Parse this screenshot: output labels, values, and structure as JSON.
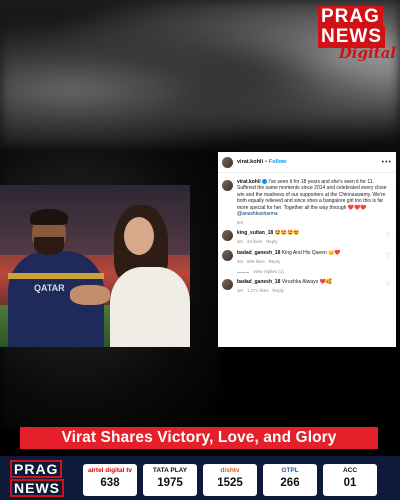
{
  "brand": {
    "logo_line1": "PRAG",
    "logo_line2": "NEWS",
    "logo_line3": "Digital",
    "footer_line1": "PRAG",
    "footer_line2": "NEWS"
  },
  "photo": {
    "jersey_text": "QATAR"
  },
  "post": {
    "username": "virat.kohli",
    "follow_label": "Follow",
    "more_label": "•••",
    "caption_user": "virat.kohli",
    "caption_text": "I've seen it for 18 years and she's seen it for 11. Suffered the same moments since 2014 and celebrated every close win and the madness of our supporters at the Chinnaswamy. We're both equally relieved and since shes a bangalore girl too this is far more special for her. Together all the way through ❤️❤️❤️",
    "caption_mention": "@anushkasharma",
    "caption_time": "9m",
    "comments": [
      {
        "user": "king_sultan_18",
        "text": "🤩🤩🤩😍",
        "time": "3m",
        "likes": "24 likes",
        "reply": "Reply"
      },
      {
        "user": "badad_ganesh_18",
        "text": "King And His Queen 👑❤️",
        "time": "3m",
        "likes": "908 likes",
        "reply": "Reply"
      },
      {
        "user": "badad_ganesh_18",
        "text": "Virushka Always ❤️🥰",
        "time": "3m",
        "likes": "1,171 likes",
        "reply": "Reply"
      }
    ],
    "view_replies": "View replies (1)"
  },
  "headline": "Virat Shares Victory, Love, and Glory",
  "ticker": [
    {
      "label": "airtel digital tv",
      "value": "638",
      "color": "#e40000"
    },
    {
      "label": "TATA PLAY",
      "value": "1975",
      "color": "#111111"
    },
    {
      "label": "dishtv",
      "value": "1525",
      "color": "#e8561c"
    },
    {
      "label": "GTPL",
      "value": "266",
      "color": "#1f5aa6"
    },
    {
      "label": "ACC",
      "value": "01",
      "color": "#111111"
    }
  ],
  "colors": {
    "accent_red": "#e5202a",
    "ticker_bg": "#0e1a3a",
    "link_blue": "#0095f6"
  }
}
